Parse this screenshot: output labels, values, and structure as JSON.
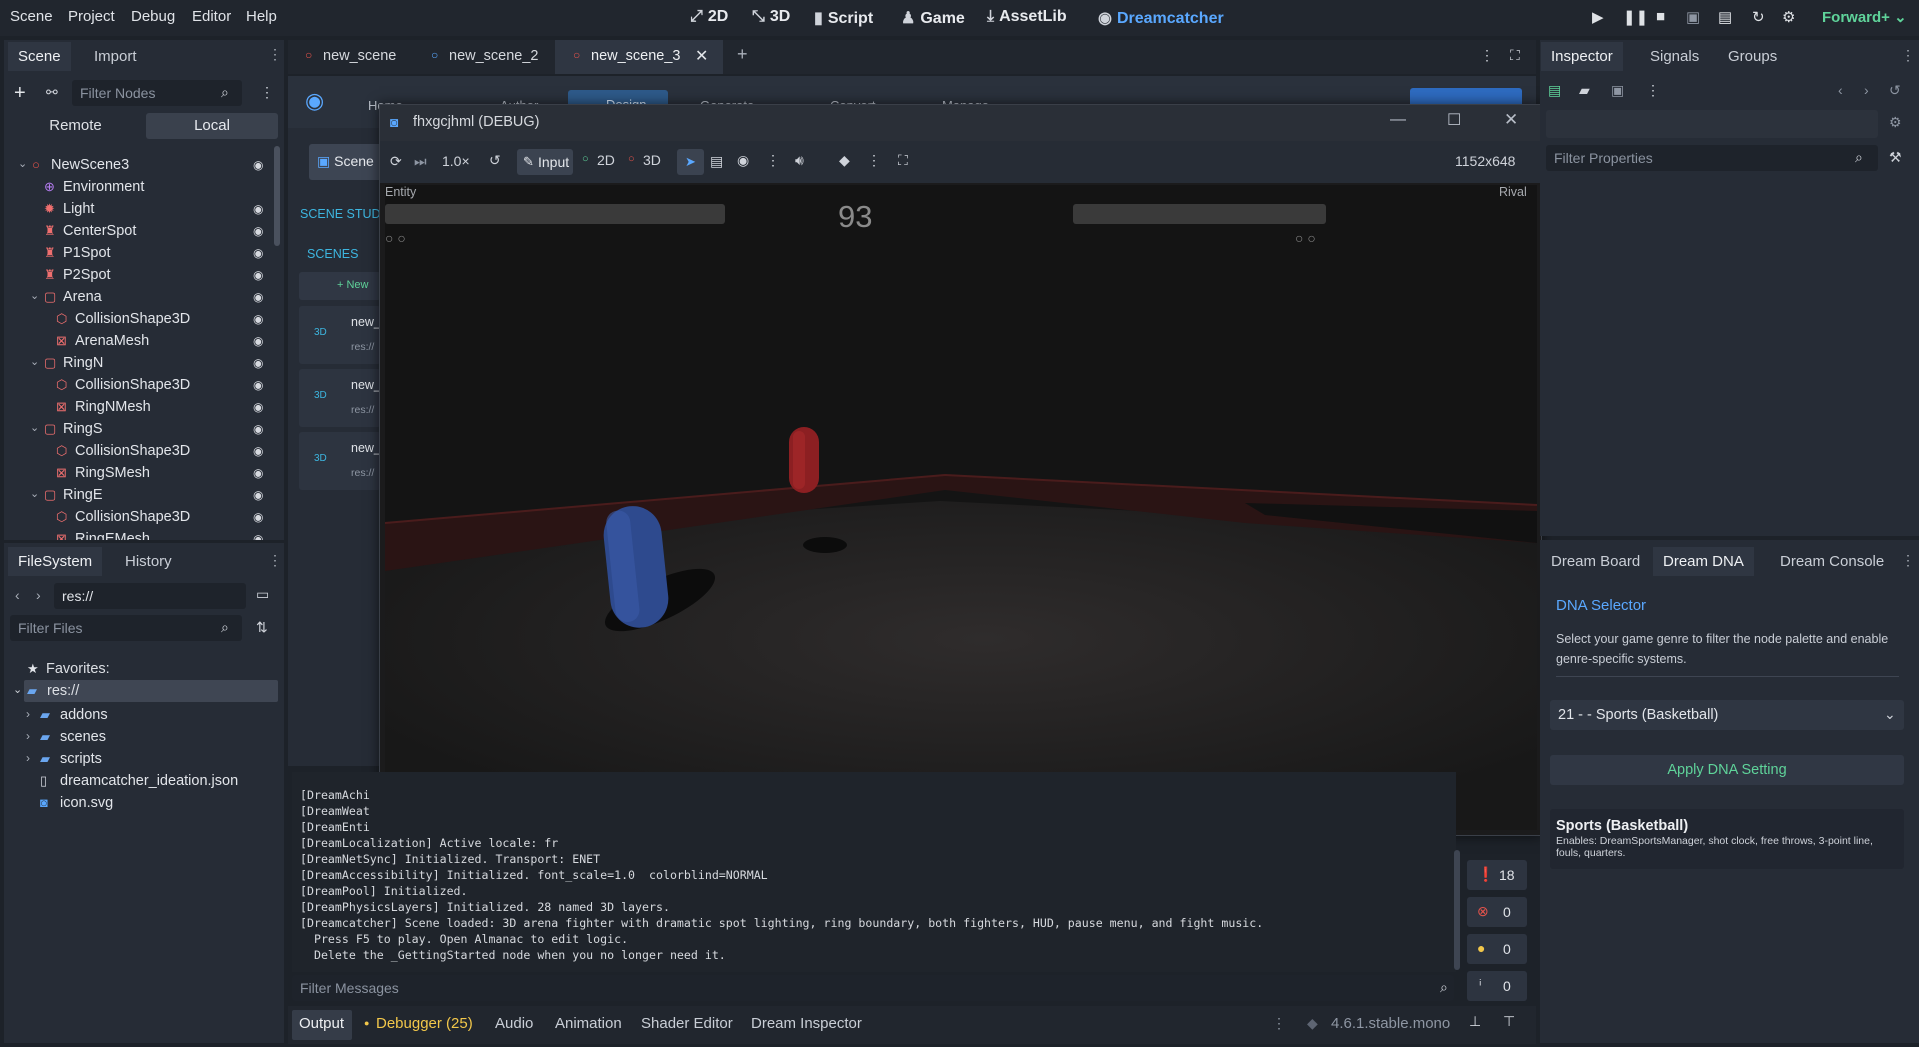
{
  "menubar": {
    "menus": [
      "Scene",
      "Project",
      "Debug",
      "Editor",
      "Help"
    ],
    "workspaces": {
      "w2d": "2D",
      "w3d": "3D",
      "script": "Script",
      "game": "Game",
      "assetlib": "AssetLib",
      "dreamcatcher": "Dreamcatcher"
    },
    "renderer": "Forward+"
  },
  "scene_dock": {
    "tabs": [
      "Scene",
      "Import"
    ],
    "filter_placeholder": "Filter Nodes",
    "remote": "Remote",
    "local": "Local",
    "nodes": [
      {
        "label": "NewScene3",
        "icon": "node3d-icon"
      },
      {
        "label": "Environment",
        "icon": "environment-icon"
      },
      {
        "label": "Light",
        "icon": "light-icon"
      },
      {
        "label": "CenterSpot",
        "icon": "marker-icon"
      },
      {
        "label": "P1Spot",
        "icon": "marker-icon"
      },
      {
        "label": "P2Spot",
        "icon": "marker-icon"
      },
      {
        "label": "Arena",
        "icon": "staticbody-icon"
      },
      {
        "label": "CollisionShape3D",
        "icon": "collision-icon"
      },
      {
        "label": "ArenaMesh",
        "icon": "mesh-icon"
      },
      {
        "label": "RingN",
        "icon": "staticbody-icon"
      },
      {
        "label": "CollisionShape3D",
        "icon": "collision-icon"
      },
      {
        "label": "RingNMesh",
        "icon": "mesh-icon"
      },
      {
        "label": "RingS",
        "icon": "staticbody-icon"
      },
      {
        "label": "CollisionShape3D",
        "icon": "collision-icon"
      },
      {
        "label": "RingSMesh",
        "icon": "mesh-icon"
      },
      {
        "label": "RingE",
        "icon": "staticbody-icon"
      },
      {
        "label": "CollisionShape3D",
        "icon": "collision-icon"
      },
      {
        "label": "RingEMesh",
        "icon": "mesh-icon"
      }
    ]
  },
  "filesystem": {
    "tabs": [
      "FileSystem",
      "History"
    ],
    "path": "res://",
    "filter_placeholder": "Filter Files",
    "favorites": "Favorites:",
    "root": "res://",
    "items": [
      "addons",
      "scenes",
      "scripts",
      "dreamcatcher_ideation.json",
      "icon.svg"
    ]
  },
  "scene_tabs": [
    "new_scene",
    "new_scene_2",
    "new_scene_3"
  ],
  "behind": {
    "toolbar": [
      "Home",
      "Author",
      "Design",
      "Generate",
      "Convert",
      "Manage"
    ],
    "scene_btn": "Scene",
    "studio_label": "SCENE STUDIO",
    "scenes_tab": "SCENES",
    "new_btn": "+ New",
    "cards": [
      {
        "tag": "3D",
        "name": "new_",
        "path": "res://"
      },
      {
        "tag": "3D",
        "name": "new_",
        "path": "res://"
      },
      {
        "tag": "3D",
        "name": "new_",
        "path": "res://"
      }
    ]
  },
  "game_window": {
    "title": "fhxgcjhml (DEBUG)",
    "speed": "1.0×",
    "input": "Input",
    "m2d": "2D",
    "m3d": "3D",
    "resolution": "1152x648",
    "hud": {
      "left_name": "Entity",
      "right_name": "Rival",
      "timer": "93"
    }
  },
  "output": {
    "lines": [
      "[DreamAchi",
      "[DreamWeat",
      "[DreamEnti",
      "[DreamLocalization] Active locale: fr",
      "[DreamNetSync] Initialized. Transport: ENET",
      "[DreamAccessibility] Initialized. font_scale=1.0  colorblind=NORMAL",
      "[DreamPool] Initialized.",
      "[DreamPhysicsLayers] Initialized. 28 named 3D layers.",
      "[Dreamcatcher] Scene loaded: 3D arena fighter with dramatic spot lighting, ring boundary, both fighters, HUD, pause menu, and fight music.",
      "  Press F5 to play. Open Almanac to edit logic.",
      "  Delete the _GettingStarted node when you no longer need it."
    ],
    "filter_placeholder": "Filter Messages",
    "counts": {
      "messages": "18",
      "errors": "0",
      "warnings": "0",
      "info": "0"
    }
  },
  "bottom_tabs": [
    "Output",
    "Debugger (25)",
    "Audio",
    "Animation",
    "Shader Editor",
    "Dream Inspector"
  ],
  "version": "4.6.1.stable.mono",
  "inspector": {
    "tabs": [
      "Inspector",
      "Signals",
      "Groups"
    ],
    "filter_placeholder": "Filter Properties"
  },
  "dream_dock": {
    "tabs": [
      "Dream Board",
      "Dream DNA",
      "Dream Console"
    ],
    "title": "DNA Selector",
    "description": "Select your game genre to filter the node palette and enable genre-specific systems.",
    "selected": "21 - - Sports (Basketball)",
    "apply": "Apply DNA Setting",
    "info_title": "Sports (Basketball)",
    "info_text": "Enables: DreamSportsManager, shot clock, free throws, 3-point line, fouls, quarters."
  },
  "colors": {
    "accent": "#5aa8ff",
    "green": "#5fd39a",
    "warning": "#f2c74a",
    "error": "#e5534b"
  }
}
